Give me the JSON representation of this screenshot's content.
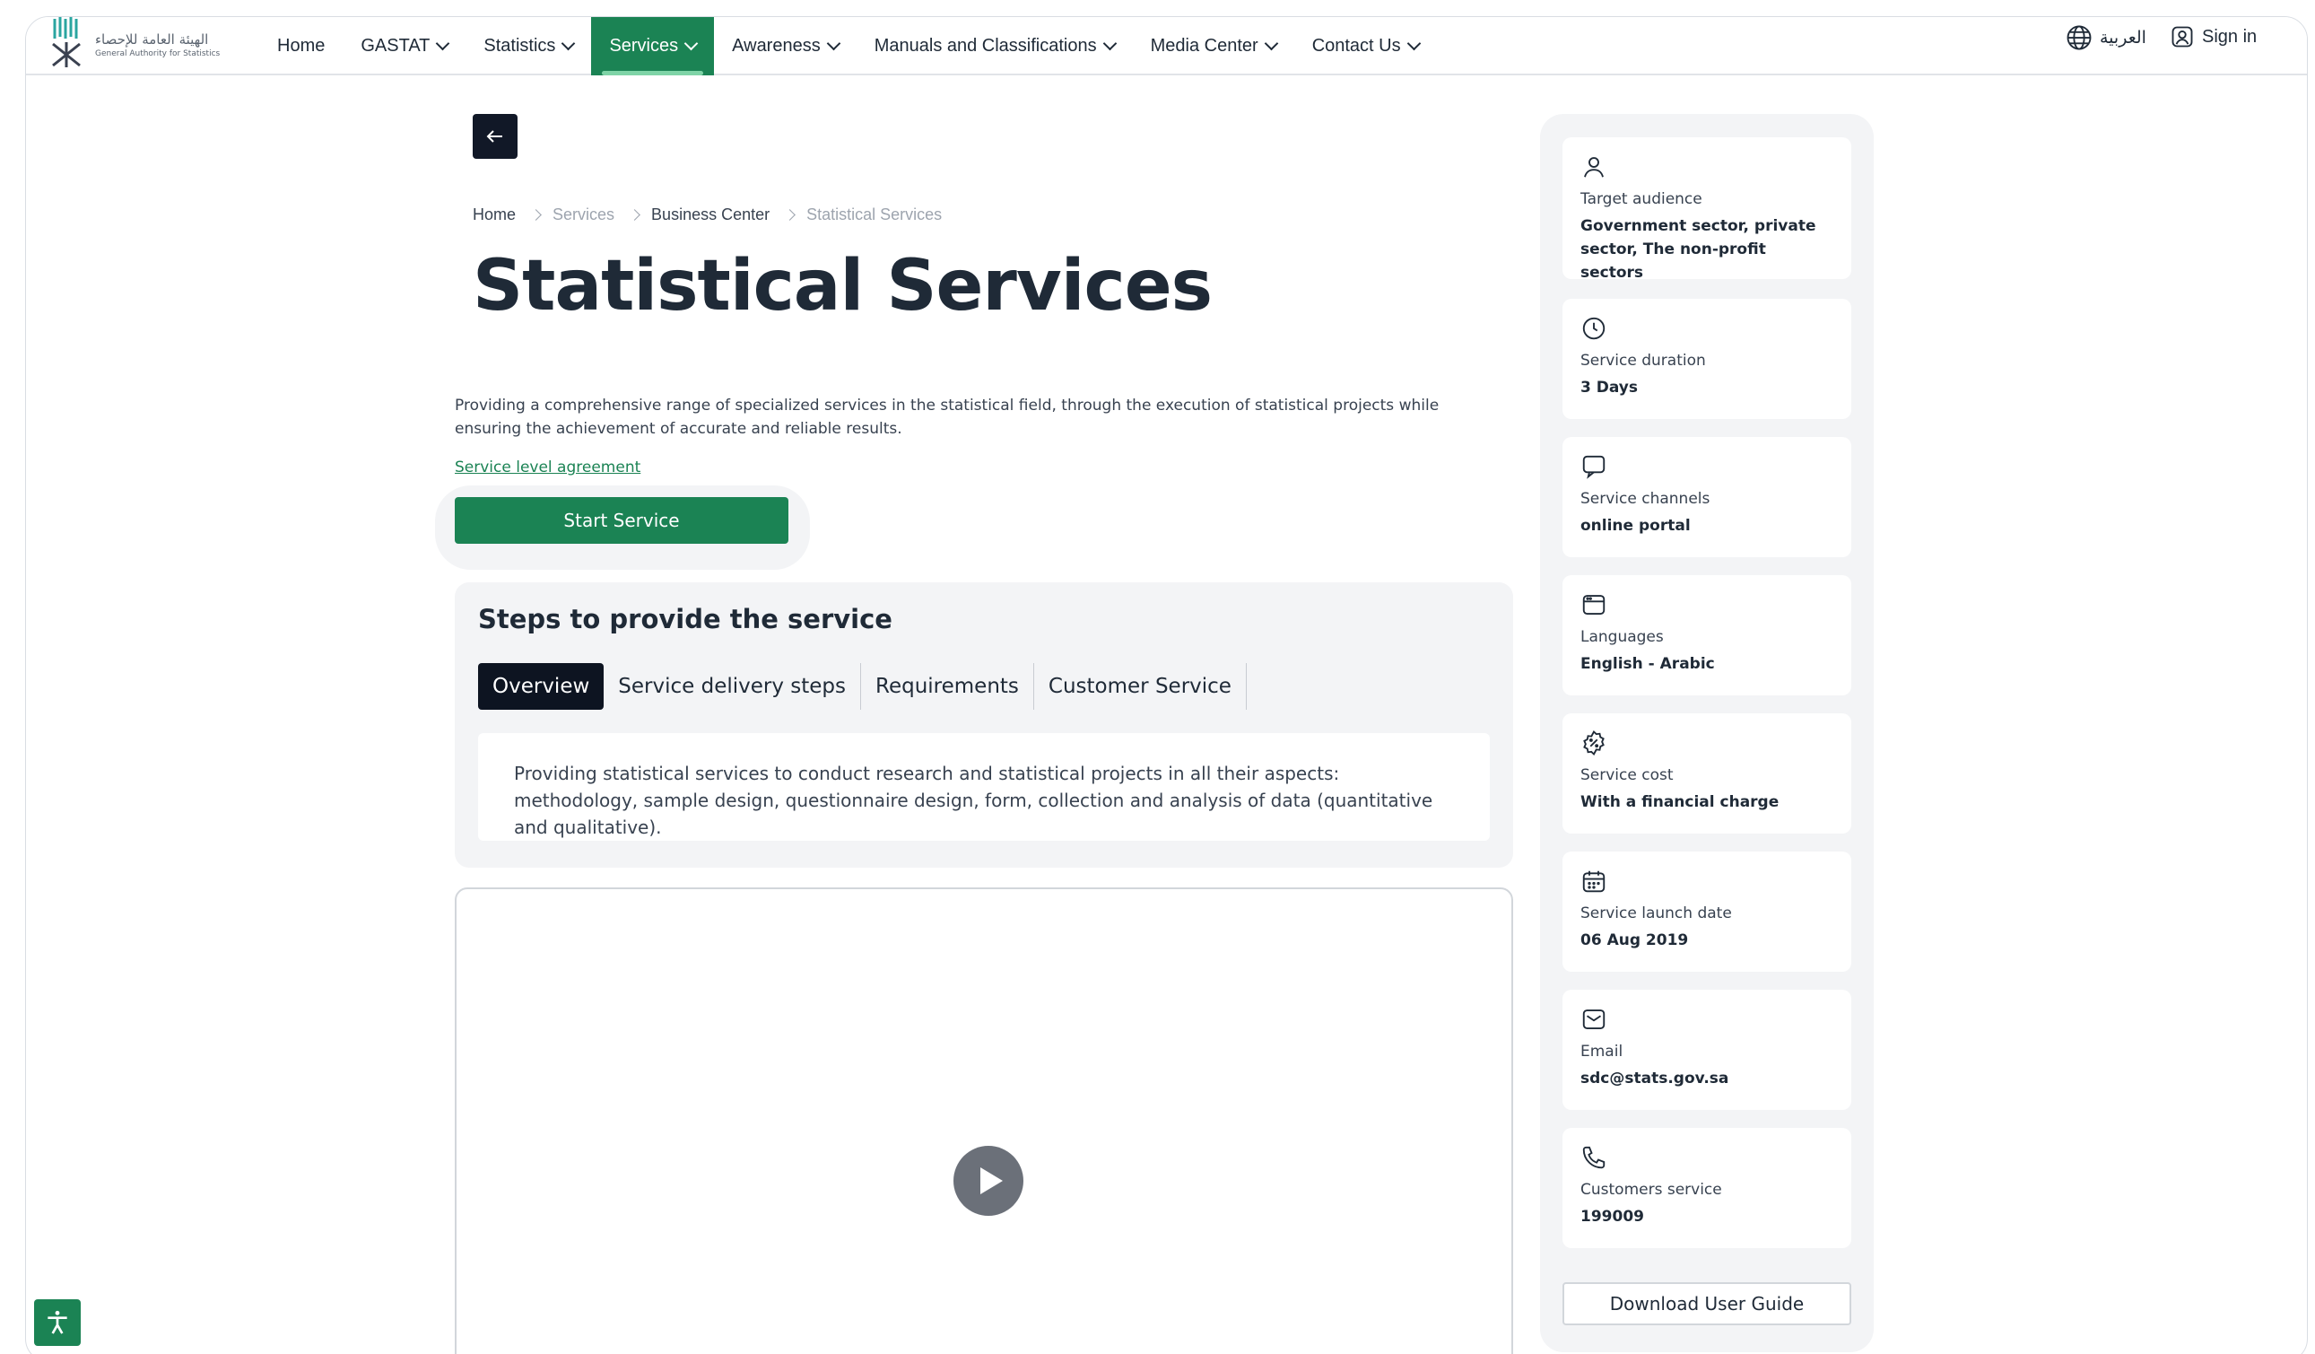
{
  "header": {
    "logo_ar": "الهيئة العامة للإحصاء",
    "logo_en": "General Authority for Statistics",
    "nav": [
      {
        "label": "Home",
        "dropdown": false
      },
      {
        "label": "GASTAT",
        "dropdown": true
      },
      {
        "label": "Statistics",
        "dropdown": true
      },
      {
        "label": "Services",
        "dropdown": true,
        "active": true
      },
      {
        "label": "Awareness",
        "dropdown": true
      },
      {
        "label": "Manuals and Classifications",
        "dropdown": true
      },
      {
        "label": "Media Center",
        "dropdown": true
      },
      {
        "label": "Contact Us",
        "dropdown": true
      }
    ],
    "language_label": "العربية",
    "signin_label": "Sign in"
  },
  "breadcrumb": [
    "Home",
    "Services",
    "Business Center",
    "Statistical Services"
  ],
  "page": {
    "title": "Statistical Services",
    "description": "Providing a comprehensive range of specialized services in the statistical field, through the execution of statistical projects while ensuring the achievement of accurate and reliable results.",
    "sla_link": "Service level agreement",
    "start_button": "Start Service"
  },
  "steps": {
    "title": "Steps to provide the service",
    "tabs": [
      "Overview",
      "Service delivery steps",
      "Requirements",
      "Customer Service"
    ],
    "active_tab": "Overview",
    "overview_text": "Providing statistical services to conduct research and statistical projects in all their aspects: methodology, sample design, questionnaire design, form, collection and analysis of data (quantitative and qualitative)."
  },
  "sidebar": {
    "cards": [
      {
        "icon": "user-icon",
        "label": "Target audience",
        "value": "Government sector, private sector, The non-profit sectors"
      },
      {
        "icon": "clock-icon",
        "label": "Service duration",
        "value": "3 Days"
      },
      {
        "icon": "chat-icon",
        "label": "Service channels",
        "value": "online portal"
      },
      {
        "icon": "browser-icon",
        "label": "Languages",
        "value": "English - Arabic"
      },
      {
        "icon": "badge-percent-icon",
        "label": "Service cost",
        "value": "With a financial charge"
      },
      {
        "icon": "calendar-icon",
        "label": "Service launch date",
        "value": "06 Aug 2019"
      },
      {
        "icon": "mail-icon",
        "label": "Email",
        "value": "sdc@stats.gov.sa"
      },
      {
        "icon": "phone-icon",
        "label": "Customers service",
        "value": "199009"
      }
    ],
    "download_button": "Download User Guide"
  },
  "colors": {
    "brand_green": "#1b8354",
    "dark": "#0d1421"
  }
}
